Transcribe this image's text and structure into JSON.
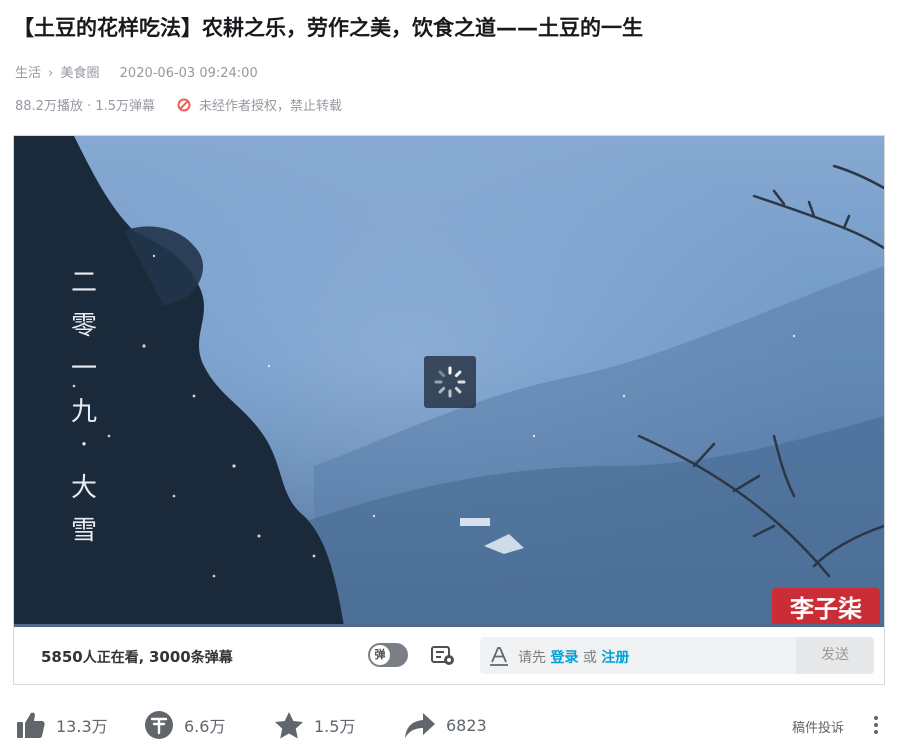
{
  "video": {
    "title": "【土豆的花样吃法】农耕之乐，劳作之美，饮食之道——土豆的一生",
    "breadcrumb": [
      "生活",
      "美食圈"
    ],
    "breadcrumb_sep": "›",
    "pubdate": "2020-06-03 09:24:00",
    "stats": "88.2万播放 · 1.5万弹幕",
    "copyright_notice": "未经作者授权，禁止转载"
  },
  "player": {
    "overlay_text": "二零一九·大雪",
    "overlay_chars": [
      "二",
      "零",
      "一",
      "九",
      "·",
      "大",
      "雪"
    ],
    "watermark": "李子柒",
    "loading": true,
    "colors": {
      "sky_top": "#7a9fc9",
      "sky_mid": "#6b93c2",
      "mist": "#5f84ad",
      "trees": "#1c2a38",
      "watermark": "#d8262a"
    }
  },
  "danmaku_bar": {
    "viewers_count": "5850",
    "viewers_suffix": "人正在看, ",
    "danmaku_count": "3000",
    "danmaku_suffix": "条弹幕",
    "toggle_label": "弹",
    "placeholder_prefix": "请先",
    "login_label": "登录",
    "or_label": "或",
    "register_label": "注册",
    "send_label": "发送"
  },
  "toolbar": {
    "like": "13.3万",
    "coin": "6.6万",
    "favorite": "1.5万",
    "share": "6823",
    "report": "稿件投诉"
  },
  "icons": [
    "ban-icon",
    "danmaku-toggle-icon",
    "danmaku-settings-icon",
    "text-style-icon",
    "thumbs-up-icon",
    "coin-icon",
    "star-icon",
    "share-icon",
    "more-icon"
  ],
  "accent_color": "#00a1d6",
  "warning_color": "#f25d59"
}
